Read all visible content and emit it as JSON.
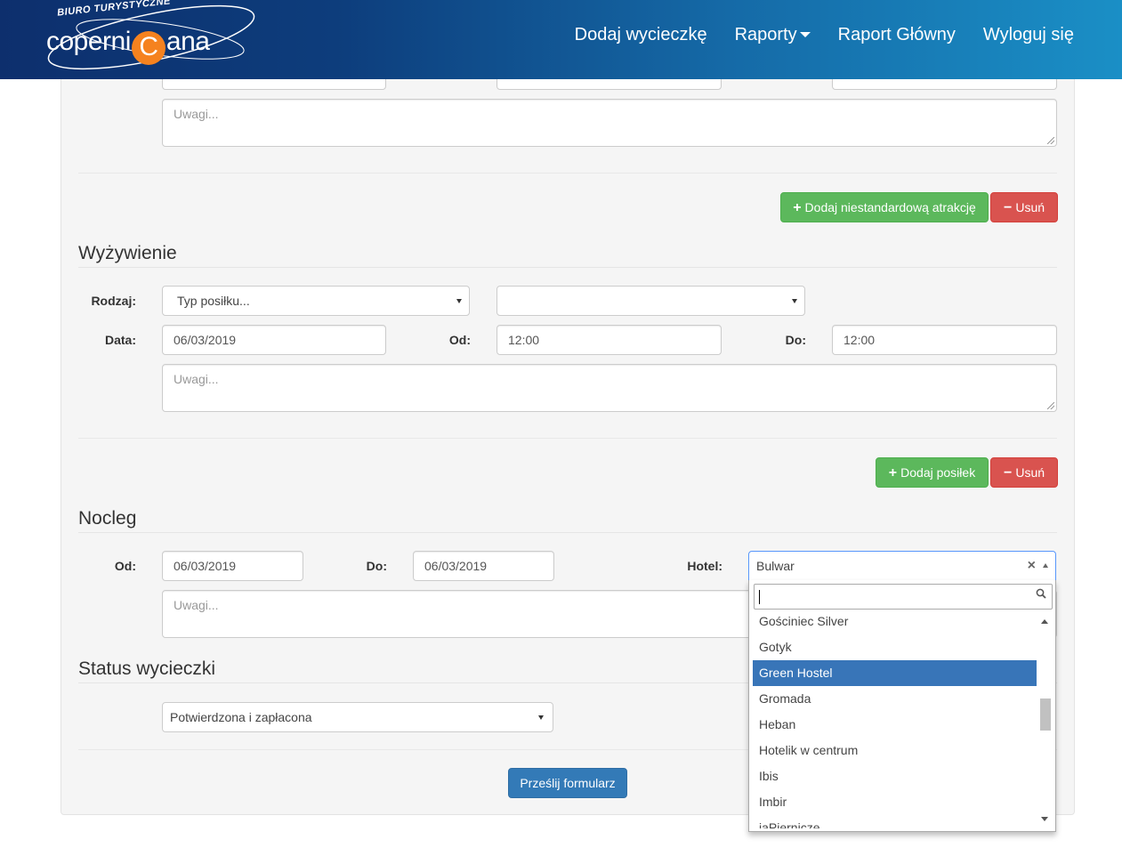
{
  "brand": {
    "subtitle": "BIURO TURYSTYCZNE",
    "word_before": "coperni",
    "word_ball": "C",
    "word_after": "ana"
  },
  "nav": {
    "add_trip": "Dodaj wycieczkę",
    "reports": "Raporty",
    "main_report": "Raport Główny",
    "logout": "Wyloguj się"
  },
  "attractions": {
    "notes_placeholder": "Uwagi...",
    "add_custom_label": "Dodaj niestandardową atrakcję",
    "remove_label": "Usuń"
  },
  "meals": {
    "title": "Wyżywienie",
    "type_label": "Rodzaj:",
    "type_placeholder": "Typ posiłku...",
    "second_select_value": "",
    "date_label": "Data:",
    "date_value": "06/03/2019",
    "from_label": "Od:",
    "from_value": "12:00",
    "to_label": "Do:",
    "to_value": "12:00",
    "notes_placeholder": "Uwagi...",
    "add_label": "Dodaj posiłek",
    "remove_label": "Usuń"
  },
  "lodging": {
    "title": "Nocleg",
    "from_label": "Od:",
    "from_value": "06/03/2019",
    "to_label": "Do:",
    "to_value": "06/03/2019",
    "hotel_label": "Hotel:",
    "hotel_value": "Bulwar",
    "clear_symbol": "×",
    "notes_placeholder": "Uwagi...",
    "hotel_search_value": "",
    "hotel_options": [
      "Gościniec Silver",
      "Gotyk",
      "Green Hostel",
      "Gromada",
      "Heban",
      "Hotelik w centrum",
      "Ibis",
      "Imbir",
      "jaPiernicze"
    ],
    "highlighted_option": "Green Hostel"
  },
  "status": {
    "title": "Status wycieczki",
    "value": "Potwierdzona i zapłacona"
  },
  "submit_label": "Prześlij formularz"
}
